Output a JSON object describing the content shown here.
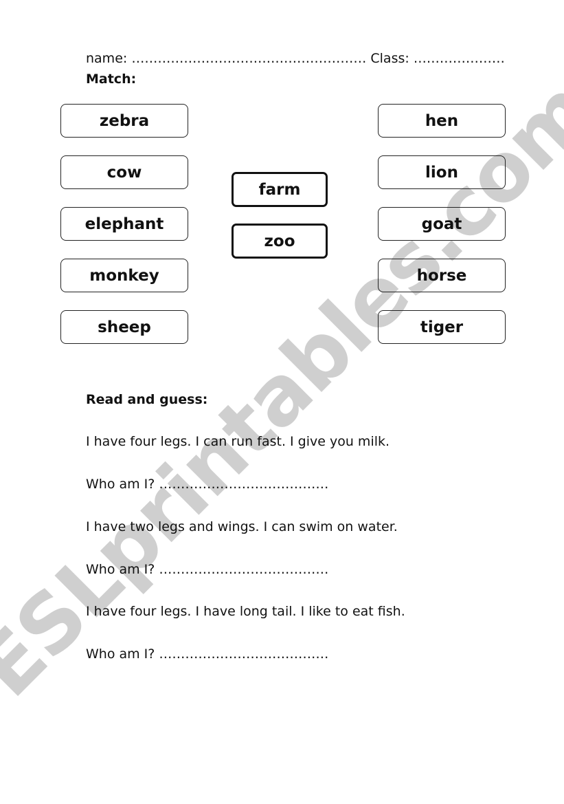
{
  "header": {
    "name_label": "name:",
    "name_blank": "………………………………………………",
    "class_label": "Class:",
    "class_blank": "…………………"
  },
  "match": {
    "title": "Match:",
    "left_words": [
      "zebra",
      "cow",
      "elephant",
      "monkey",
      "sheep"
    ],
    "center_words": [
      "farm",
      "zoo"
    ],
    "right_words": [
      "hen",
      "lion",
      "goat",
      "horse",
      "tiger"
    ]
  },
  "guess": {
    "title": "Read and guess:",
    "items": [
      {
        "clue": "I have four legs. I can run fast. I give you milk.",
        "prompt": "Who am I?",
        "blank": "…………………………………"
      },
      {
        "clue": "I have two legs and wings. I can swim on water.",
        "prompt": "Who am I?",
        "blank": "…………………………………"
      },
      {
        "clue": "I have four legs. I have long tail. I like to eat fish.",
        "prompt": "Who am I?",
        "blank": "…………………………………"
      }
    ]
  },
  "watermark": {
    "text": "ESLprintables.com",
    "color": "#cfcfcf"
  }
}
